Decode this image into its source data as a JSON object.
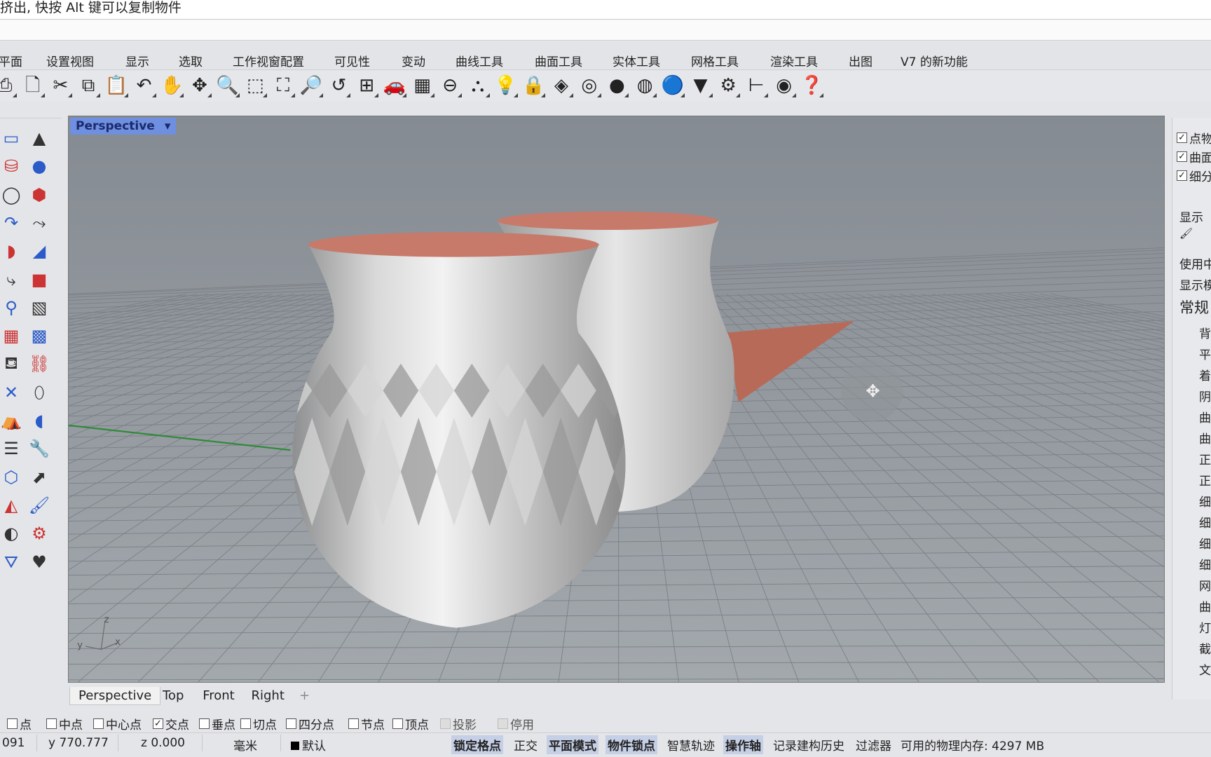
{
  "command": {
    "prompt": "挤出, 快按 Alt 键可以复制物件"
  },
  "menu_tabs": [
    "平面",
    "设置视图",
    "显示",
    "选取",
    "工作视窗配置",
    "可见性",
    "变动",
    "曲线工具",
    "曲面工具",
    "实体工具",
    "网格工具",
    "渲染工具",
    "出图",
    "V7 的新功能"
  ],
  "toolbar_icons": [
    "print-icon",
    "new-file-icon",
    "cut-icon",
    "copy-icon",
    "paste-icon",
    "undo-icon",
    "pan-hand-icon",
    "rotate-view-icon",
    "zoom-icon",
    "zoom-window-icon",
    "zoom-extents-icon",
    "zoom-selected-icon",
    "undo-view-icon",
    "four-viewports-icon",
    "car-icon",
    "grid-snap-icon",
    "circle-point-icon",
    "object-snap-icon",
    "light-bulb-icon",
    "lock-icon",
    "layer-icon",
    "color-wheel-icon",
    "sphere-icon",
    "wireframe-sphere-icon",
    "render-sphere-icon",
    "cone-filter-icon",
    "gear-icon",
    "dimension-icon",
    "radar-icon",
    "help-icon"
  ],
  "left_toolbar_icons": [
    "plane-icon",
    "cone-icon",
    "cylinder-icon",
    "sphere-icon",
    "torus-icon",
    "box-icon",
    "extrude-icon",
    "loft-icon",
    "surface-icon",
    "patch-icon",
    "sweep-icon",
    "solid-icon",
    "pipe-icon",
    "network-icon",
    "grid-icon",
    "mesh-icon",
    "cup-icon",
    "bridge-icon",
    "explode-icon",
    "eraser-icon",
    "drape-icon",
    "revolve-icon",
    "list-icon",
    "tools-icon",
    "cage-icon",
    "blend-icon",
    "flow-icon",
    "brush-icon",
    "ball-icon",
    "gumball-icon",
    "funnel-icon",
    "heart-icon"
  ],
  "viewport": {
    "title": "Perspective",
    "axes": {
      "x": "x",
      "y": "y",
      "z": "z"
    }
  },
  "viewport_tabs": [
    "Perspective",
    "Top",
    "Front",
    "Right"
  ],
  "osnap": [
    {
      "label": "点",
      "checked": false
    },
    {
      "label": "中点",
      "checked": false
    },
    {
      "label": "中心点",
      "checked": false
    },
    {
      "label": "交点",
      "checked": true
    },
    {
      "label": "垂点",
      "checked": false
    },
    {
      "label": "切点",
      "checked": false
    },
    {
      "label": "四分点",
      "checked": false
    },
    {
      "label": "节点",
      "checked": false
    },
    {
      "label": "顶点",
      "checked": false
    },
    {
      "label": "投影",
      "checked": false,
      "disabled": true
    },
    {
      "label": "停用",
      "checked": false,
      "disabled": true
    }
  ],
  "status": {
    "x": "091",
    "y": "y 770.777",
    "z": "z 0.000",
    "unit": "毫米",
    "layer": "默认",
    "toggles": [
      {
        "label": "锁定格点",
        "on": true
      },
      {
        "label": "正交",
        "on": false
      },
      {
        "label": "平面模式",
        "on": true
      },
      {
        "label": "物件锁点",
        "on": true
      },
      {
        "label": "智慧轨迹",
        "on": false
      },
      {
        "label": "操作轴",
        "on": true
      },
      {
        "label": "记录建构历史",
        "on": false
      },
      {
        "label": "过滤器",
        "on": false
      }
    ],
    "memory": "可用的物理内存: 4297 MB"
  },
  "right_panel": {
    "checks": [
      "点物",
      "曲面",
      "细分"
    ],
    "section": "显示",
    "rows": [
      "使用中",
      "显示模",
      "常规"
    ],
    "items": [
      "背",
      "平",
      "着",
      "阴",
      "曲",
      "曲",
      "正",
      "正",
      "细",
      "细",
      "细",
      "细",
      "网",
      "曲",
      "灯",
      "截",
      "文"
    ]
  },
  "colors": {
    "viewport_title": "#6f8fe0",
    "vase_inner": "#c77a6a",
    "active_toggle": "#c5cfe6"
  }
}
